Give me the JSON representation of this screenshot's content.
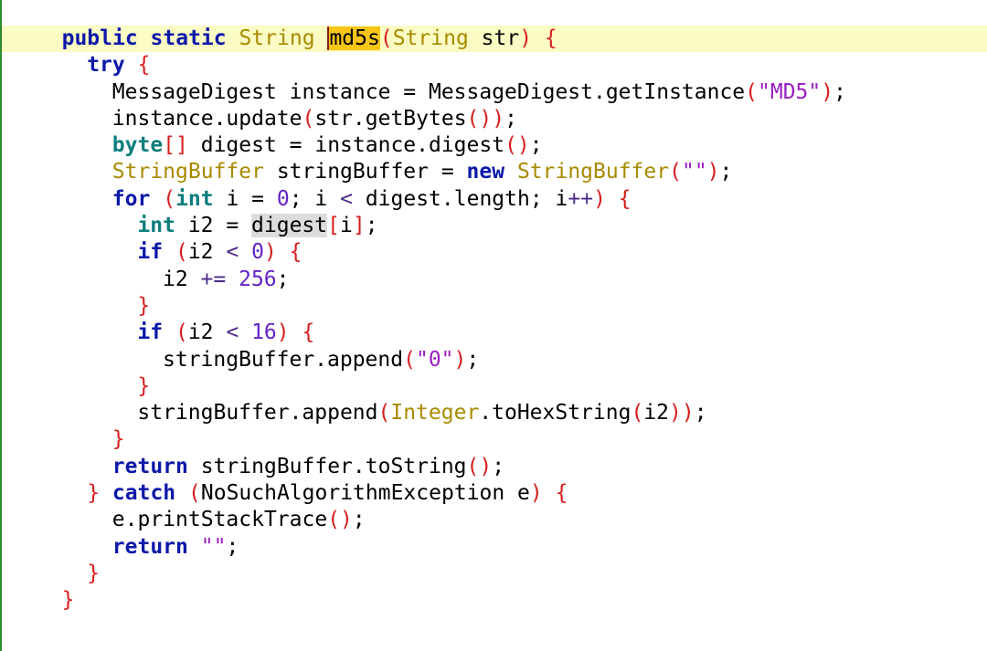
{
  "editor": {
    "lines": [
      {
        "indent": 2,
        "current": true,
        "tokens": [
          {
            "t": "public",
            "c": "kw"
          },
          {
            "t": " ",
            "c": "pl"
          },
          {
            "t": "static",
            "c": "kw"
          },
          {
            "t": " ",
            "c": "pl"
          },
          {
            "t": "String",
            "c": "cls"
          },
          {
            "t": " ",
            "c": "pl"
          },
          {
            "t": "md5s",
            "c": "pl",
            "h": "search"
          },
          {
            "t": "(",
            "c": "br"
          },
          {
            "t": "String",
            "c": "cls"
          },
          {
            "t": " str",
            "c": "pl"
          },
          {
            "t": ")",
            "c": "br"
          },
          {
            "t": " ",
            "c": "pl"
          },
          {
            "t": "{",
            "c": "br"
          }
        ]
      },
      {
        "indent": 4,
        "tokens": [
          {
            "t": "try",
            "c": "kw"
          },
          {
            "t": " ",
            "c": "pl"
          },
          {
            "t": "{",
            "c": "br"
          }
        ]
      },
      {
        "indent": 6,
        "tokens": [
          {
            "t": "MessageDigest instance = MessageDigest.getInstance",
            "c": "pl"
          },
          {
            "t": "(",
            "c": "br"
          },
          {
            "t": "\"MD5\"",
            "c": "str"
          },
          {
            "t": ")",
            "c": "br"
          },
          {
            "t": ";",
            "c": "pl"
          }
        ]
      },
      {
        "indent": 6,
        "tokens": [
          {
            "t": "instance.update",
            "c": "pl"
          },
          {
            "t": "(",
            "c": "br"
          },
          {
            "t": "str.getBytes",
            "c": "pl"
          },
          {
            "t": "())",
            "c": "br"
          },
          {
            "t": ";",
            "c": "pl"
          }
        ]
      },
      {
        "indent": 6,
        "tokens": [
          {
            "t": "byte",
            "c": "ty"
          },
          {
            "t": "[]",
            "c": "br"
          },
          {
            "t": " digest = instance.digest",
            "c": "pl"
          },
          {
            "t": "()",
            "c": "br"
          },
          {
            "t": ";",
            "c": "pl"
          }
        ]
      },
      {
        "indent": 6,
        "tokens": [
          {
            "t": "StringBuffer",
            "c": "cls"
          },
          {
            "t": " stringBuffer = ",
            "c": "pl"
          },
          {
            "t": "new",
            "c": "kw"
          },
          {
            "t": " ",
            "c": "pl"
          },
          {
            "t": "StringBuffer",
            "c": "cls"
          },
          {
            "t": "(",
            "c": "br"
          },
          {
            "t": "\"\"",
            "c": "str"
          },
          {
            "t": ")",
            "c": "br"
          },
          {
            "t": ";",
            "c": "pl"
          }
        ]
      },
      {
        "indent": 6,
        "tokens": [
          {
            "t": "for",
            "c": "kw"
          },
          {
            "t": " ",
            "c": "pl"
          },
          {
            "t": "(",
            "c": "br"
          },
          {
            "t": "int",
            "c": "ty"
          },
          {
            "t": " i = ",
            "c": "pl"
          },
          {
            "t": "0",
            "c": "num"
          },
          {
            "t": "; i ",
            "c": "pl"
          },
          {
            "t": "<",
            "c": "op"
          },
          {
            "t": " digest.length; i",
            "c": "pl"
          },
          {
            "t": "++",
            "c": "op"
          },
          {
            "t": ")",
            "c": "br"
          },
          {
            "t": " ",
            "c": "pl"
          },
          {
            "t": "{",
            "c": "br"
          }
        ]
      },
      {
        "indent": 8,
        "tokens": [
          {
            "t": "int",
            "c": "ty"
          },
          {
            "t": " i2 = ",
            "c": "pl"
          },
          {
            "t": "digest",
            "c": "pl",
            "h": "ref"
          },
          {
            "t": "[",
            "c": "br"
          },
          {
            "t": "i",
            "c": "pl"
          },
          {
            "t": "]",
            "c": "br"
          },
          {
            "t": ";",
            "c": "pl"
          }
        ]
      },
      {
        "indent": 8,
        "tokens": [
          {
            "t": "if",
            "c": "kw"
          },
          {
            "t": " ",
            "c": "pl"
          },
          {
            "t": "(",
            "c": "br"
          },
          {
            "t": "i2 ",
            "c": "pl"
          },
          {
            "t": "<",
            "c": "op"
          },
          {
            "t": " ",
            "c": "pl"
          },
          {
            "t": "0",
            "c": "num"
          },
          {
            "t": ")",
            "c": "br"
          },
          {
            "t": " ",
            "c": "pl"
          },
          {
            "t": "{",
            "c": "br"
          }
        ]
      },
      {
        "indent": 10,
        "tokens": [
          {
            "t": "i2 ",
            "c": "pl"
          },
          {
            "t": "+=",
            "c": "op"
          },
          {
            "t": " ",
            "c": "pl"
          },
          {
            "t": "256",
            "c": "num"
          },
          {
            "t": ";",
            "c": "pl"
          }
        ]
      },
      {
        "indent": 8,
        "tokens": [
          {
            "t": "}",
            "c": "br"
          }
        ]
      },
      {
        "indent": 8,
        "tokens": [
          {
            "t": "if",
            "c": "kw"
          },
          {
            "t": " ",
            "c": "pl"
          },
          {
            "t": "(",
            "c": "br"
          },
          {
            "t": "i2 ",
            "c": "pl"
          },
          {
            "t": "<",
            "c": "op"
          },
          {
            "t": " ",
            "c": "pl"
          },
          {
            "t": "16",
            "c": "num"
          },
          {
            "t": ")",
            "c": "br"
          },
          {
            "t": " ",
            "c": "pl"
          },
          {
            "t": "{",
            "c": "br"
          }
        ]
      },
      {
        "indent": 10,
        "tokens": [
          {
            "t": "stringBuffer.append",
            "c": "pl"
          },
          {
            "t": "(",
            "c": "br"
          },
          {
            "t": "\"0\"",
            "c": "str"
          },
          {
            "t": ")",
            "c": "br"
          },
          {
            "t": ";",
            "c": "pl"
          }
        ]
      },
      {
        "indent": 8,
        "tokens": [
          {
            "t": "}",
            "c": "br"
          }
        ]
      },
      {
        "indent": 8,
        "tokens": [
          {
            "t": "stringBuffer.append",
            "c": "pl"
          },
          {
            "t": "(",
            "c": "br"
          },
          {
            "t": "Integer",
            "c": "cls"
          },
          {
            "t": ".toHexString",
            "c": "pl"
          },
          {
            "t": "(",
            "c": "br"
          },
          {
            "t": "i2",
            "c": "pl"
          },
          {
            "t": "))",
            "c": "br"
          },
          {
            "t": ";",
            "c": "pl"
          }
        ]
      },
      {
        "indent": 6,
        "tokens": [
          {
            "t": "}",
            "c": "br"
          }
        ]
      },
      {
        "indent": 6,
        "tokens": [
          {
            "t": "return",
            "c": "kw"
          },
          {
            "t": " stringBuffer.toString",
            "c": "pl"
          },
          {
            "t": "()",
            "c": "br"
          },
          {
            "t": ";",
            "c": "pl"
          }
        ]
      },
      {
        "indent": 4,
        "tokens": [
          {
            "t": "}",
            "c": "br"
          },
          {
            "t": " ",
            "c": "pl"
          },
          {
            "t": "catch",
            "c": "kw"
          },
          {
            "t": " ",
            "c": "pl"
          },
          {
            "t": "(",
            "c": "br"
          },
          {
            "t": "NoSuchAlgorithmException e",
            "c": "pl"
          },
          {
            "t": ")",
            "c": "br"
          },
          {
            "t": " ",
            "c": "pl"
          },
          {
            "t": "{",
            "c": "br"
          }
        ]
      },
      {
        "indent": 6,
        "tokens": [
          {
            "t": "e.printStackTrace",
            "c": "pl"
          },
          {
            "t": "()",
            "c": "br"
          },
          {
            "t": ";",
            "c": "pl"
          }
        ]
      },
      {
        "indent": 6,
        "tokens": [
          {
            "t": "return",
            "c": "kw"
          },
          {
            "t": " ",
            "c": "pl"
          },
          {
            "t": "\"\"",
            "c": "str"
          },
          {
            "t": ";",
            "c": "pl"
          }
        ]
      },
      {
        "indent": 4,
        "tokens": [
          {
            "t": "}",
            "c": "br"
          }
        ]
      },
      {
        "indent": 2,
        "tokens": [
          {
            "t": "}",
            "c": "br"
          }
        ]
      },
      {
        "indent": 0,
        "tokens": [
          {
            "t": "",
            "c": "pl"
          }
        ]
      }
    ]
  }
}
